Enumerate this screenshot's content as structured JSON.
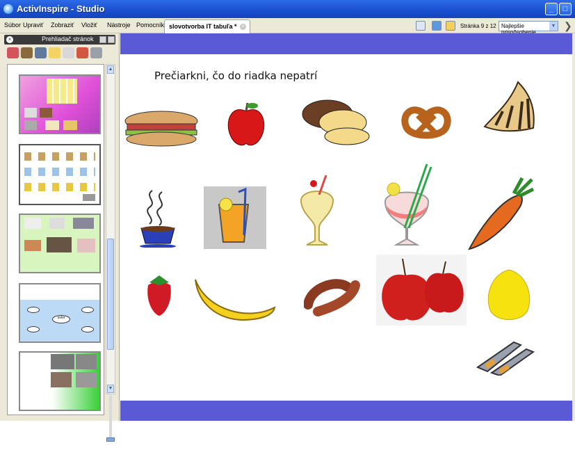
{
  "window": {
    "title": "ActivInspire - Studio"
  },
  "menu": [
    "Súbor",
    "Upraviť",
    "Zobraziť",
    "Vložiť",
    "Nástroje",
    "Pomocník"
  ],
  "document_tab": {
    "label": "slovotvorba IT tabuľa *"
  },
  "toolbar": {
    "page_info": "Stránka 9 z 12",
    "zoom_value": "Najlepšie prispôsobenie"
  },
  "sidebar": {
    "title": "Prehliadač stránok"
  },
  "canvas": {
    "heading": "Prečiarkni, čo do riadka nepatrí",
    "rows": [
      [
        "sandwich",
        "apple",
        "bread",
        "pretzel",
        "croissant"
      ],
      [
        "coffee-cup",
        "orange-juice",
        "milkshake",
        "cocktail",
        "carrot"
      ],
      [
        "strawberry",
        "banana",
        "sausage",
        "red-apples",
        "lemon"
      ],
      [
        "pens"
      ]
    ]
  },
  "thumbnail_texts": {
    "page4_center": "ovlor"
  },
  "colors": {
    "frame_bar": "#5a5ad6",
    "titlebar": "#1a4fcf",
    "chrome": "#ece9d8"
  }
}
